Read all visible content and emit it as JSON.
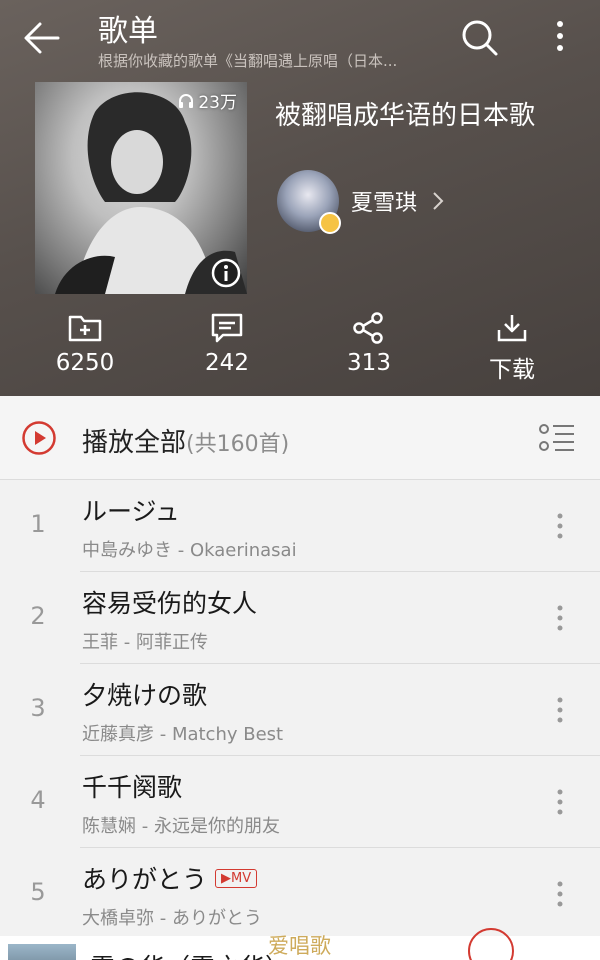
{
  "header": {
    "title": "歌单",
    "subtitle": "根据你收藏的歌单《当翻唱遇上原唱（日本...",
    "playlist_title": "被翻唱成华语的日本歌",
    "play_count": "23万",
    "creator_name": "夏雪琪"
  },
  "actions": [
    {
      "icon": "add-folder-icon",
      "label": "6250"
    },
    {
      "icon": "comment-icon",
      "label": "242"
    },
    {
      "icon": "share-icon",
      "label": "313"
    },
    {
      "icon": "download-icon",
      "label": "下载"
    }
  ],
  "list": {
    "play_all": "播放全部",
    "count": "(共160首)",
    "songs": [
      {
        "num": "1",
        "title": "ルージュ",
        "sub": "中島みゆき - Okaerinasai",
        "mv": ""
      },
      {
        "num": "2",
        "title": "容易受伤的女人",
        "sub": "王菲 - 阿菲正传",
        "mv": ""
      },
      {
        "num": "3",
        "title": "夕焼けの歌",
        "sub": "近藤真彦 - Matchy Best",
        "mv": ""
      },
      {
        "num": "4",
        "title": "千千阕歌",
        "sub": "陈慧娴 - 永远是你的朋友",
        "mv": ""
      },
      {
        "num": "5",
        "title": "ありがとう",
        "sub": "大橋卓弥 - ありがとう",
        "mv": "▶MV"
      }
    ],
    "partial_title": "雪の华（雪之华）",
    "watermark": "爱唱歌"
  },
  "colors": {
    "accent": "#d33a31",
    "header_bg": "#57504c",
    "badge": "#f6c344"
  }
}
